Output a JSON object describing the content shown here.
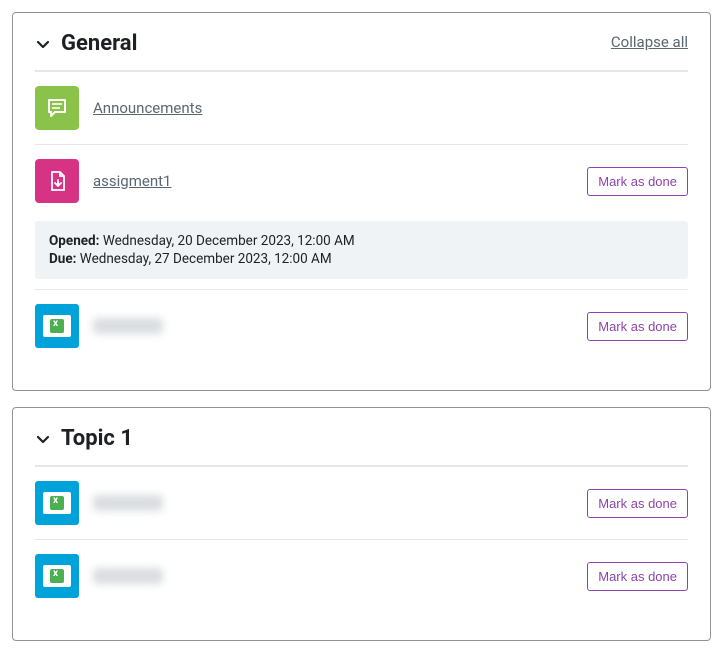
{
  "collapseAllLabel": "Collapse all",
  "markDoneLabel": "Mark as done",
  "colors": {
    "forumIcon": "#8bc34a",
    "assignIcon": "#d63384",
    "excelIcon": "#00a3d9",
    "markDoneBorder": "#8e44ad"
  },
  "sections": [
    {
      "title": "General",
      "hasCollapseAll": true,
      "items": [
        {
          "type": "forum",
          "name": "Announcements",
          "markDone": false
        },
        {
          "type": "assign",
          "name": "assigment1",
          "markDone": true,
          "dates": {
            "openedLabel": "Opened:",
            "openedValue": "Wednesday, 20 December 2023, 12:00 AM",
            "dueLabel": "Due:",
            "dueValue": "Wednesday, 27 December 2023, 12:00 AM"
          }
        },
        {
          "type": "excel",
          "name": "",
          "blurred": true,
          "markDone": true
        }
      ]
    },
    {
      "title": "Topic 1",
      "hasCollapseAll": false,
      "items": [
        {
          "type": "excel",
          "name": "",
          "blurred": true,
          "markDone": true
        },
        {
          "type": "excel",
          "name": "",
          "blurred": true,
          "markDone": true
        }
      ]
    }
  ]
}
